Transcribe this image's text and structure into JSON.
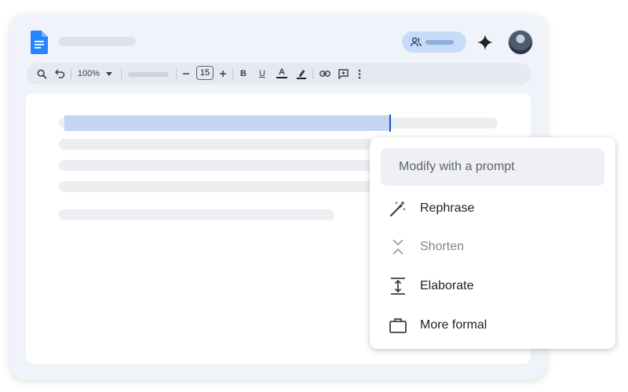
{
  "toolbar": {
    "zoom": "100%",
    "font_size": "15",
    "bold_glyph": "B",
    "underline_glyph": "U",
    "text_color_glyph": "A"
  },
  "menu": {
    "prompt_placeholder": "Modify with a prompt",
    "items": [
      {
        "label": "Rephrase",
        "icon": "magic-wand-icon",
        "enabled": true
      },
      {
        "label": "Shorten",
        "icon": "collapse-icon",
        "enabled": false
      },
      {
        "label": "Elaborate",
        "icon": "expand-icon",
        "enabled": true
      },
      {
        "label": "More formal",
        "icon": "briefcase-icon",
        "enabled": true
      }
    ]
  },
  "colors": {
    "accent": "#1a73e8",
    "selection": "#c5d5f2",
    "window_bg": "#f1f3fb"
  }
}
